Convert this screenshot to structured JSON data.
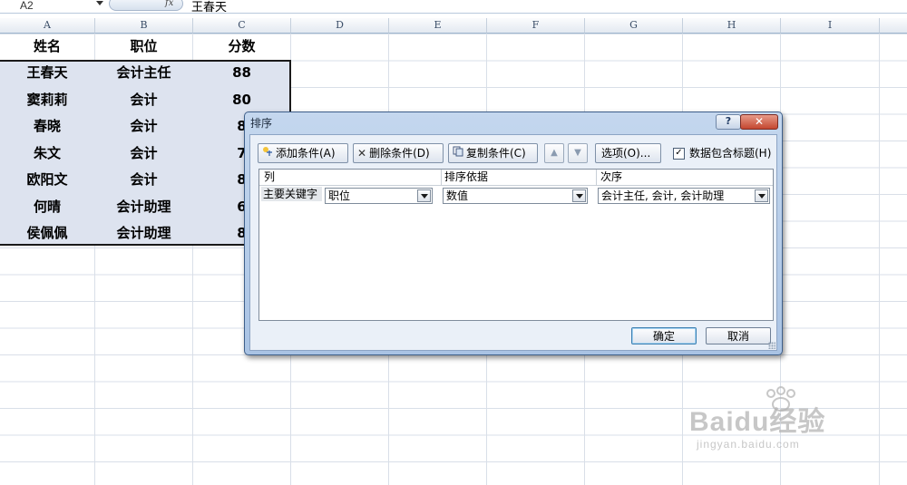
{
  "formula_bar": {
    "name_box": "A2",
    "fx_symbol": "fx",
    "value": "王春天"
  },
  "columns": [
    "A",
    "B",
    "C",
    "D",
    "E",
    "F",
    "G",
    "H",
    "I"
  ],
  "headers": {
    "name": "姓名",
    "position": "职位",
    "score": "分数"
  },
  "rows": [
    {
      "name": "王春天",
      "position": "会计主任",
      "score": "88"
    },
    {
      "name": "窦莉莉",
      "position": "会计",
      "score": "80"
    },
    {
      "name": "春晓",
      "position": "会计",
      "score": "8"
    },
    {
      "name": "朱文",
      "position": "会计",
      "score": "7"
    },
    {
      "name": "欧阳文",
      "position": "会计",
      "score": "8"
    },
    {
      "name": "何晴",
      "position": "会计助理",
      "score": "6"
    },
    {
      "name": "侯佩佩",
      "position": "会计助理",
      "score": "8"
    }
  ],
  "dialog": {
    "title": "排序",
    "help": "?",
    "close": "✕",
    "add_condition": "添加条件(A)",
    "delete_condition": "删除条件(D)",
    "copy_condition": "复制条件(C)",
    "options": "选项(O)...",
    "has_header_label": "数据包含标题(H)",
    "has_header_checked": "✓",
    "table_headers": {
      "column": "列",
      "sort_on": "排序依据",
      "order": "次序"
    },
    "row": {
      "label": "主要关键字",
      "column": "职位",
      "sort_on": "数值",
      "order": "会计主任, 会计, 会计助理"
    },
    "ok": "确定",
    "cancel": "取消"
  },
  "watermark": {
    "brand": "Baidu经验",
    "url": "jingyan.baidu.com"
  }
}
